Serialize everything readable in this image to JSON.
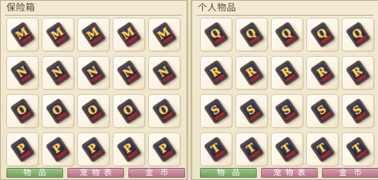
{
  "left_panel": {
    "title": "保险箱",
    "rows": [
      [
        "M",
        "M",
        "M",
        "M",
        "M"
      ],
      [
        "N",
        "N",
        "N",
        "N",
        "N"
      ],
      [
        "O",
        "O",
        "O",
        "O",
        "O"
      ],
      [
        "P",
        "P",
        "P",
        "P",
        "P"
      ]
    ],
    "tabs": [
      {
        "label": "物品",
        "color": "#7fab68"
      },
      {
        "label": "宠物表",
        "color": "#c47c93"
      },
      {
        "label": "金币",
        "color": "#c47c93"
      }
    ]
  },
  "right_panel": {
    "title": "个人物品",
    "rows": [
      [
        "Q",
        "Q",
        "Q",
        "Q",
        "Q"
      ],
      [
        "R",
        "R",
        "R",
        "R",
        "R"
      ],
      [
        "S",
        "S",
        "S",
        "S",
        "S"
      ],
      [
        "T",
        "T",
        "T",
        "T",
        "T"
      ]
    ],
    "tabs": [
      {
        "label": "物品",
        "color": "#7fab68"
      },
      {
        "label": "宠物表",
        "color": "#c47c93"
      },
      {
        "label": "金币",
        "color": "#c47c93"
      }
    ]
  },
  "icons": {
    "slot_item": "letter-card-icon"
  },
  "colors": {
    "panel_background": "#f1e7cf",
    "tab_active": "#7fab68",
    "tab_inactive": "#c47c93"
  }
}
